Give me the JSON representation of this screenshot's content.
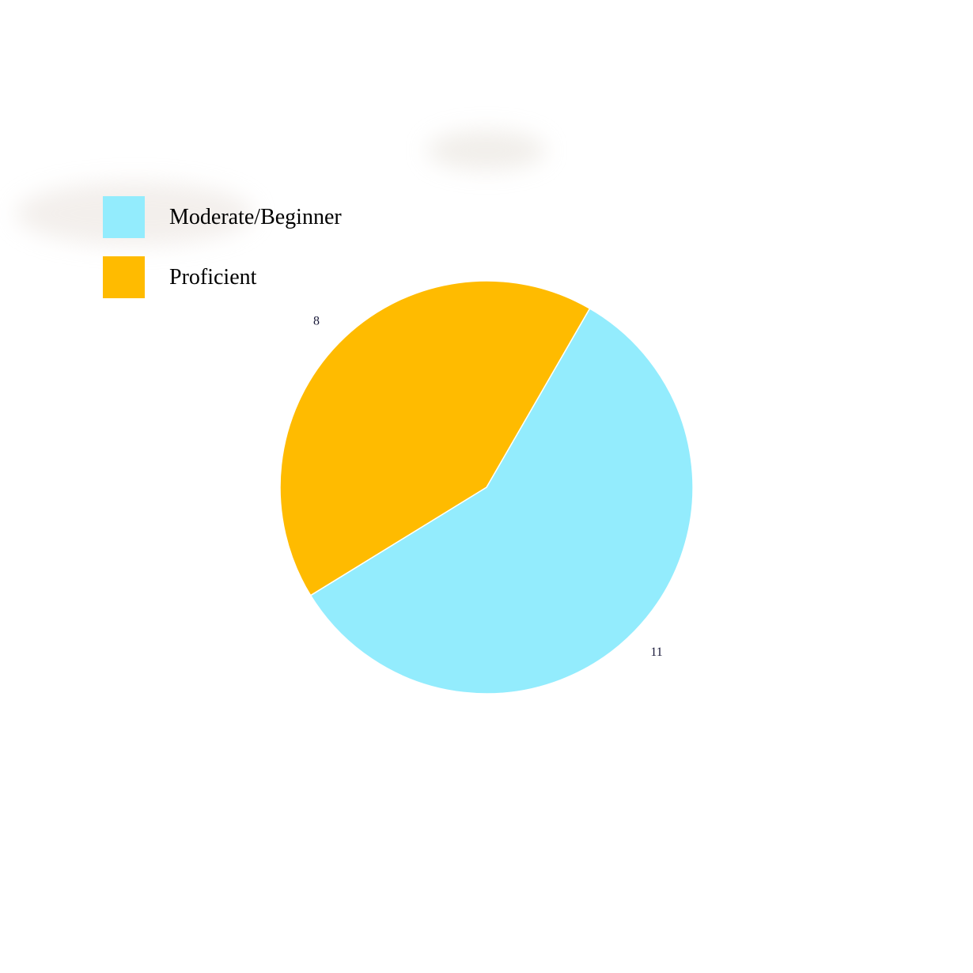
{
  "colors": {
    "background": "#ffffff",
    "slice_separator": "#ffffff",
    "label_text": "#1a1a3a"
  },
  "chart_data": {
    "type": "pie",
    "title": "",
    "start_angle_deg": -60,
    "direction": "clockwise",
    "legend_position": "top-left",
    "slices": [
      {
        "label": "Moderate/Beginner",
        "value": 11,
        "value_label": "11",
        "color": "#93ecfd"
      },
      {
        "label": "Proficient",
        "value": 8,
        "value_label": "8",
        "color": "#ffbb00"
      }
    ]
  }
}
